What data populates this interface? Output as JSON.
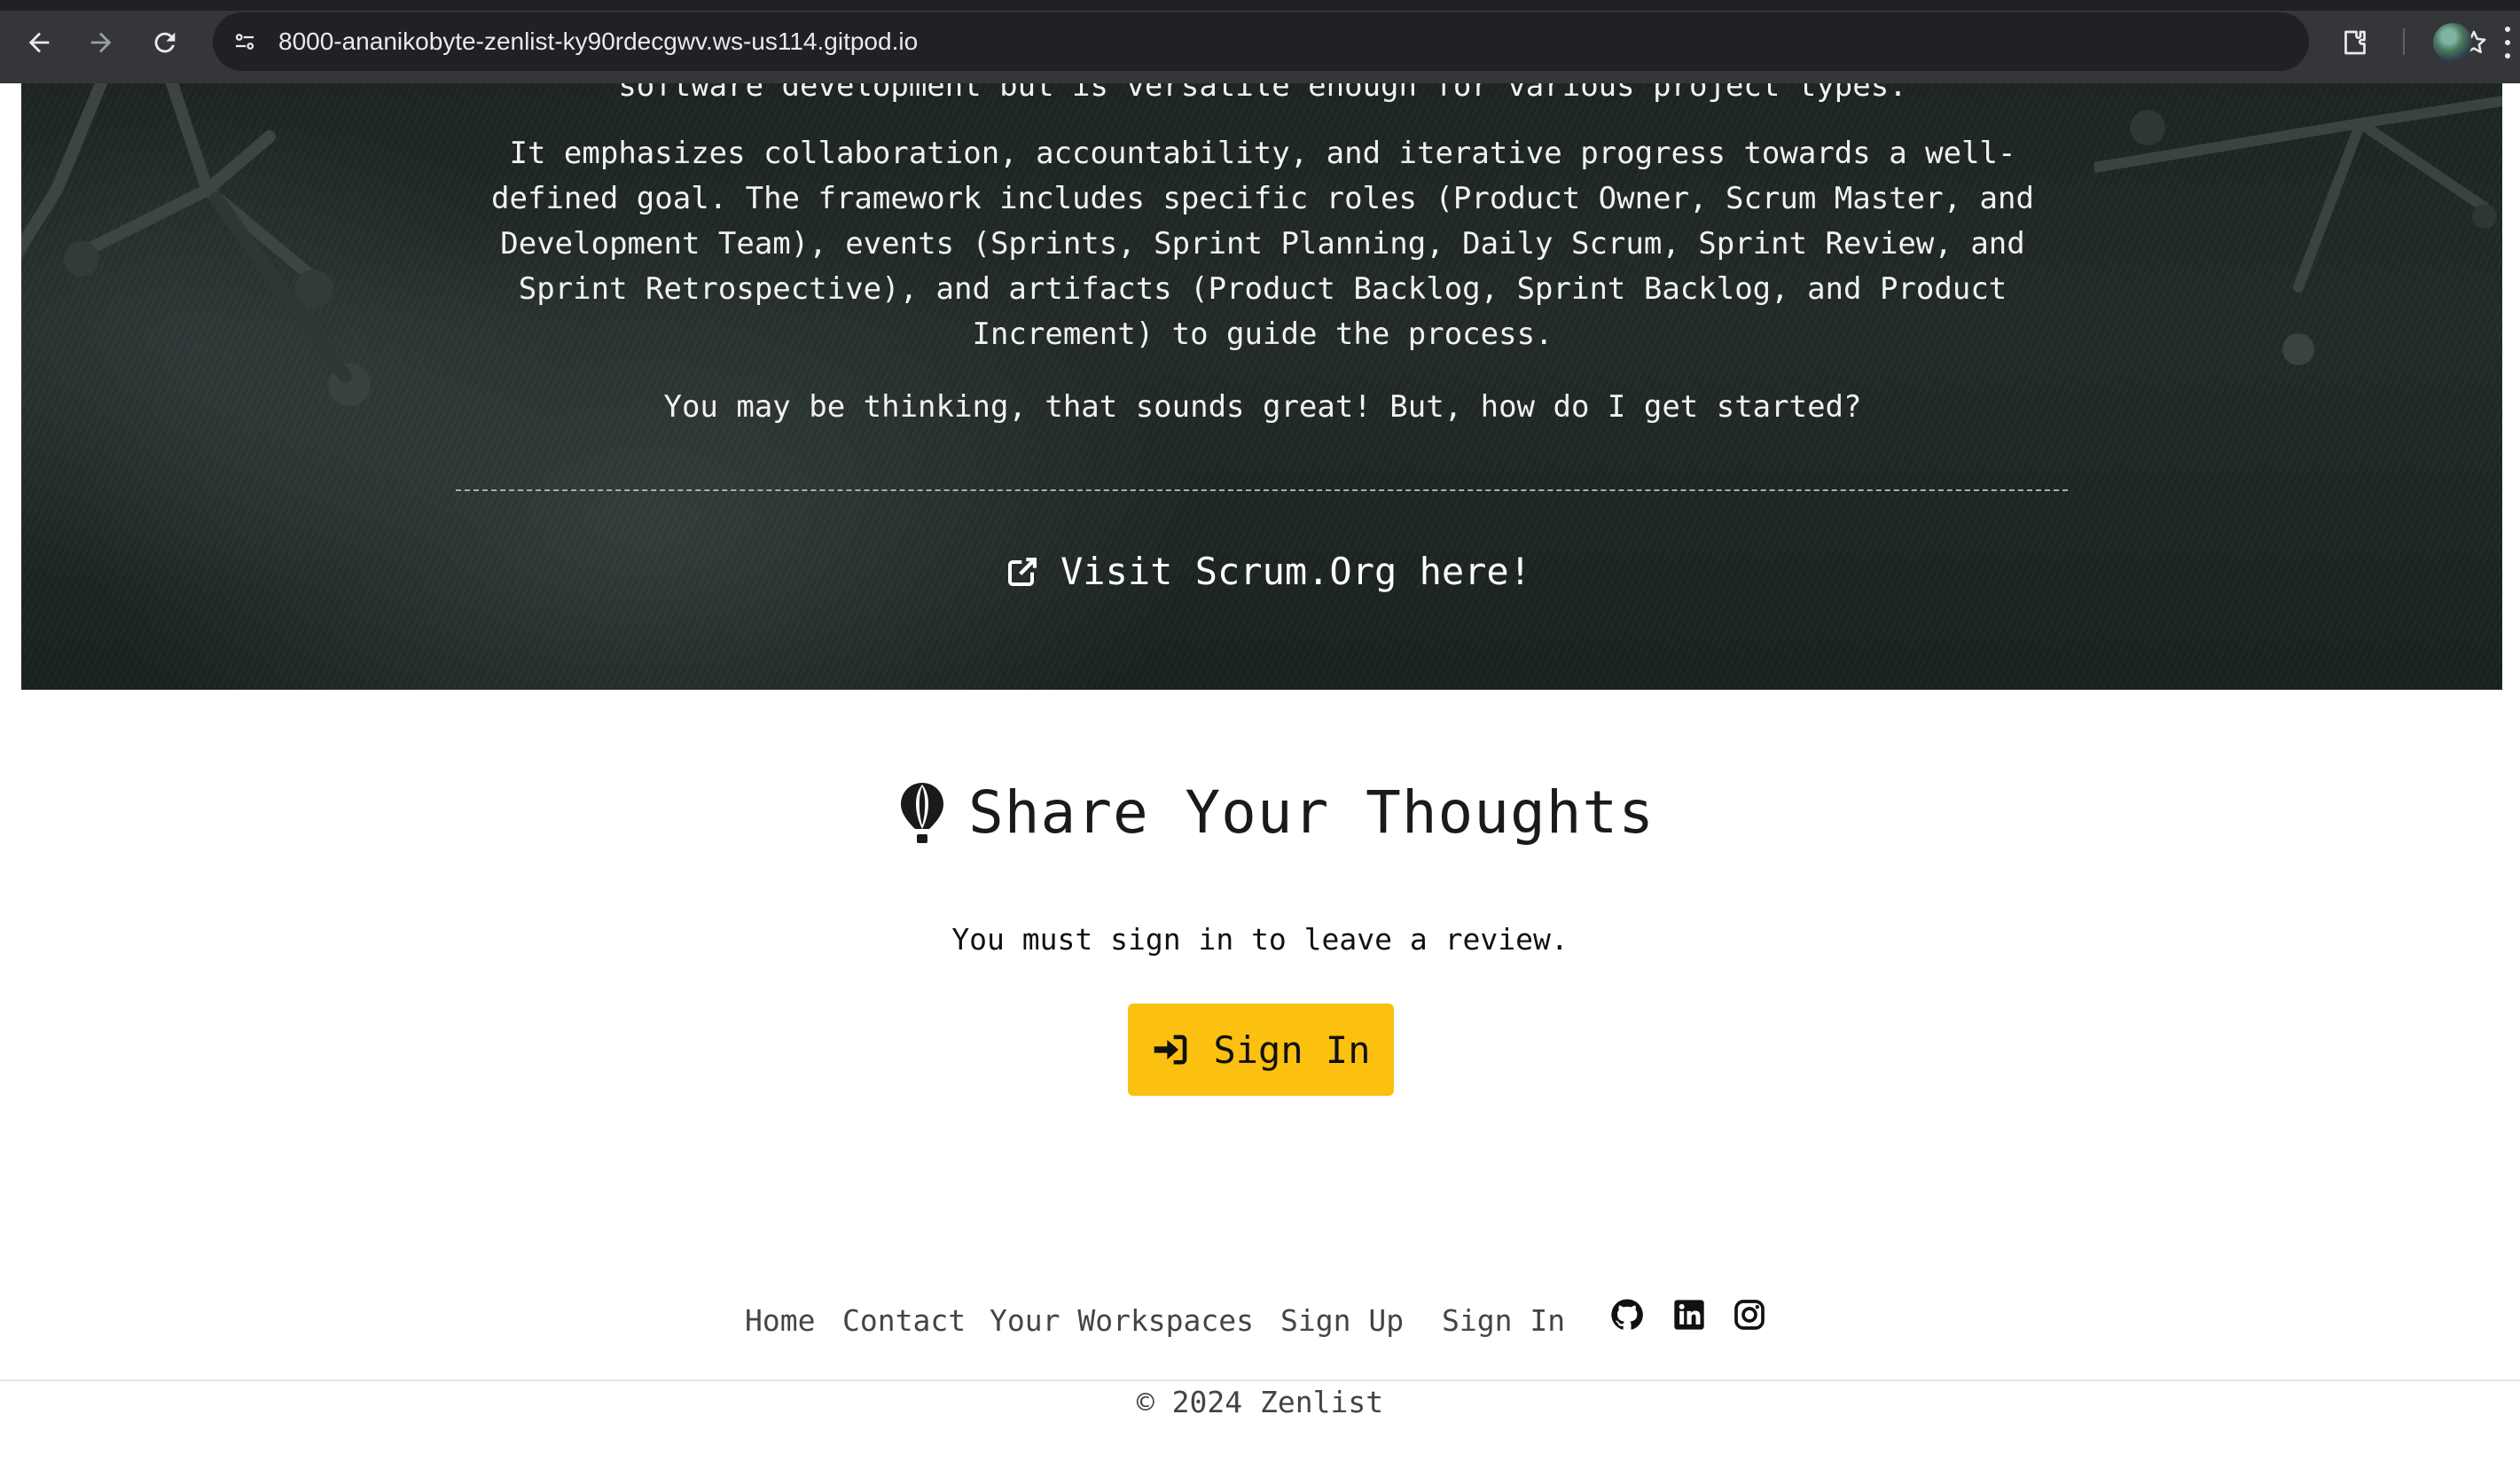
{
  "browser": {
    "url": "8000-ananikobyte-zenlist-ky90rdecgwv.ws-us114.gitpod.io"
  },
  "hero": {
    "cut_text": "software development but is versatile enough for various project types.",
    "paragraph1": "It emphasizes collaboration, accountability, and iterative progress towards a well-defined goal. The framework includes specific roles (Product Owner, Scrum Master, and Development Team), events (Sprints, Sprint Planning, Daily Scrum, Sprint Review, and Sprint Retrospective), and artifacts (Product Backlog, Sprint Backlog, and Product Increment) to guide the process.",
    "paragraph2": "You may be thinking, that sounds great! But, how do I get started?",
    "link_label": "Visit Scrum.Org here!"
  },
  "thoughts": {
    "title": "Share Your Thoughts",
    "message": "You must sign in to leave a review.",
    "button_label": "Sign In",
    "button_color": "#fcc010"
  },
  "footer": {
    "links": [
      "Home",
      "Contact",
      "Your Workspaces",
      "Sign Up",
      "Sign In"
    ],
    "social_icons": [
      "github-icon",
      "linkedin-icon",
      "instagram-icon"
    ],
    "copyright": "© 2024 Zenlist"
  }
}
